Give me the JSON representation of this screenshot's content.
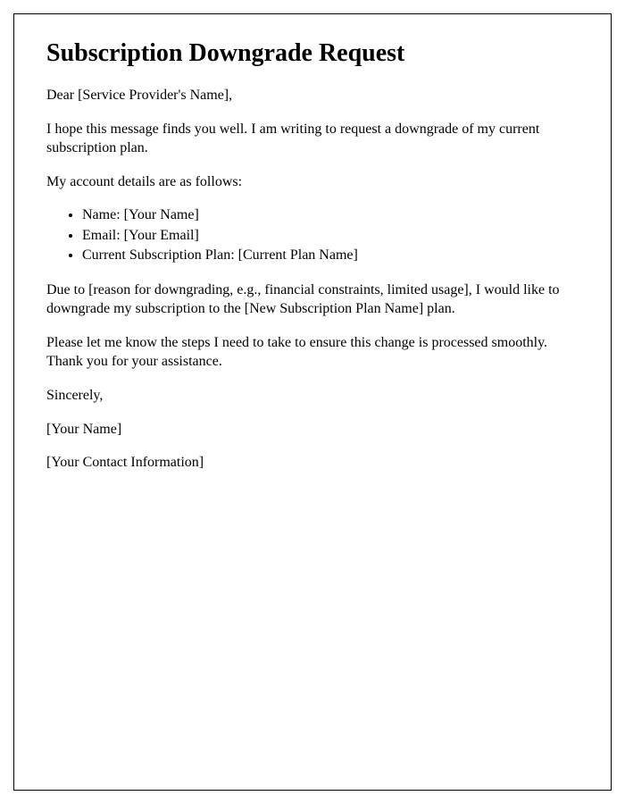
{
  "title": "Subscription Downgrade Request",
  "greeting": "Dear [Service Provider's Name],",
  "intro": "I hope this message finds you well. I am writing to request a downgrade of my current subscription plan.",
  "details_intro": "My account details are as follows:",
  "details": {
    "name": "Name: [Your Name]",
    "email": "Email: [Your Email]",
    "plan": "Current Subscription Plan: [Current Plan Name]"
  },
  "reason": "Due to [reason for downgrading, e.g., financial constraints, limited usage], I would like to downgrade my subscription to the [New Subscription Plan Name] plan.",
  "closing_request": "Please let me know the steps I need to take to ensure this change is processed smoothly. Thank you for your assistance.",
  "signoff": "Sincerely,",
  "signature_name": "[Your Name]",
  "signature_contact": "[Your Contact Information]"
}
